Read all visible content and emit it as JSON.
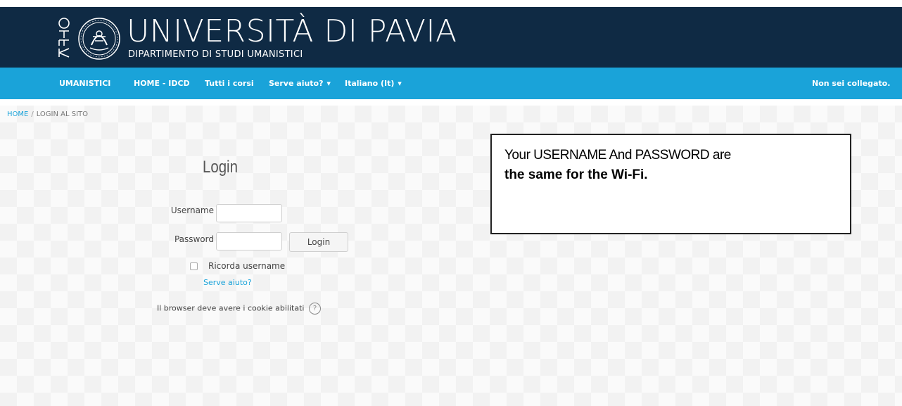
{
  "header": {
    "kiro_logo_text": "KIRO",
    "title": "UNIVERSITÀ DI PAVIA",
    "subtitle": "DIPARTIMENTO DI STUDI UMANISTICI"
  },
  "nav": {
    "items": [
      {
        "label": "UMANISTICI"
      },
      {
        "label": "HOME - IDCD"
      },
      {
        "label": "Tutti i corsi"
      },
      {
        "label": "Serve aiuto?"
      },
      {
        "label": "Italiano (It)"
      }
    ],
    "user_status": "Non sei collegato."
  },
  "breadcrumb": {
    "home": "HOME",
    "separator": "/",
    "current": "LOGIN AL SITO"
  },
  "login": {
    "title": "Login",
    "username_label": "Username",
    "username_value": "",
    "password_label": "Password",
    "password_value": "",
    "button_label": "Login",
    "remember_label": "Ricorda username",
    "remember_checked": false,
    "help_link": "Serve aiuto?",
    "cookie_notice": "Il browser deve avere i cookie abilitati",
    "help_icon": "?"
  },
  "note": {
    "line1": "Your USERNAME And PASSWORD are",
    "line2": "the same for the Wi-Fi."
  },
  "colors": {
    "header_bg": "#0f2a44",
    "navbar_bg": "#1aa3d9",
    "link": "#1aa3d9"
  }
}
